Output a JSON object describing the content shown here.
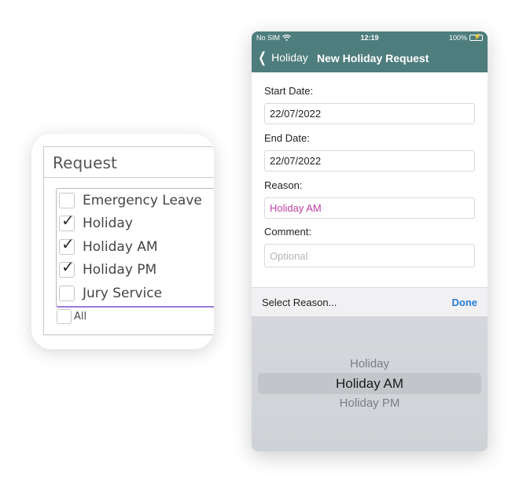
{
  "request_card": {
    "title": "Request",
    "options": [
      {
        "label": "Emergency Leave",
        "checked": false
      },
      {
        "label": "Holiday",
        "checked": true
      },
      {
        "label": "Holiday AM",
        "checked": true
      },
      {
        "label": "Holiday PM",
        "checked": true
      },
      {
        "label": "Jury Service",
        "checked": false
      }
    ],
    "all_label": "All",
    "tick": "✓"
  },
  "status_bar": {
    "carrier": "No SIM",
    "time": "12:19",
    "battery": "100%"
  },
  "nav": {
    "back_label": "Holiday",
    "title": "New Holiday Request"
  },
  "form": {
    "start_label": "Start Date:",
    "start_value": "22/07/2022",
    "end_label": "End Date:",
    "end_value": "22/07/2022",
    "reason_label": "Reason:",
    "reason_value": "Holiday AM",
    "comment_label": "Comment:",
    "comment_placeholder": "Optional"
  },
  "picker": {
    "label": "Select Reason...",
    "done_label": "Done",
    "options": [
      "Holiday",
      "Holiday AM",
      "Holiday PM"
    ],
    "selected": "Holiday AM"
  },
  "colors": {
    "header": "#4e7d7d",
    "reason_text": "#c23fa3",
    "done_blue": "#2a7bd8",
    "list_focus_border": "#9c7ad8"
  }
}
